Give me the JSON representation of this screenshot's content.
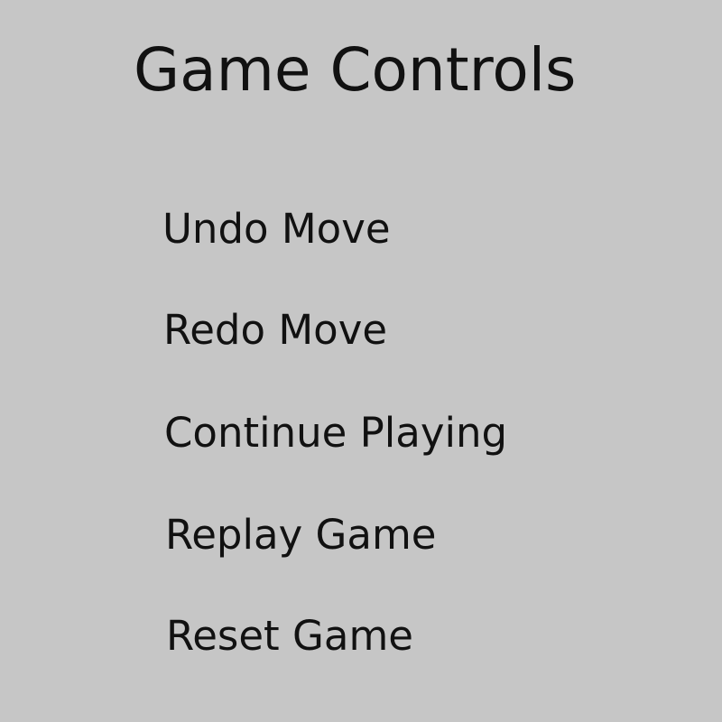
{
  "title": "Game Controls",
  "menu": {
    "items": [
      {
        "label": "Undo Move"
      },
      {
        "label": "Redo Move"
      },
      {
        "label": "Continue Playing"
      },
      {
        "label": "Replay Game"
      },
      {
        "label": "Reset Game"
      }
    ]
  },
  "colors": {
    "background": "#c6c6c6",
    "text": "#111111"
  }
}
